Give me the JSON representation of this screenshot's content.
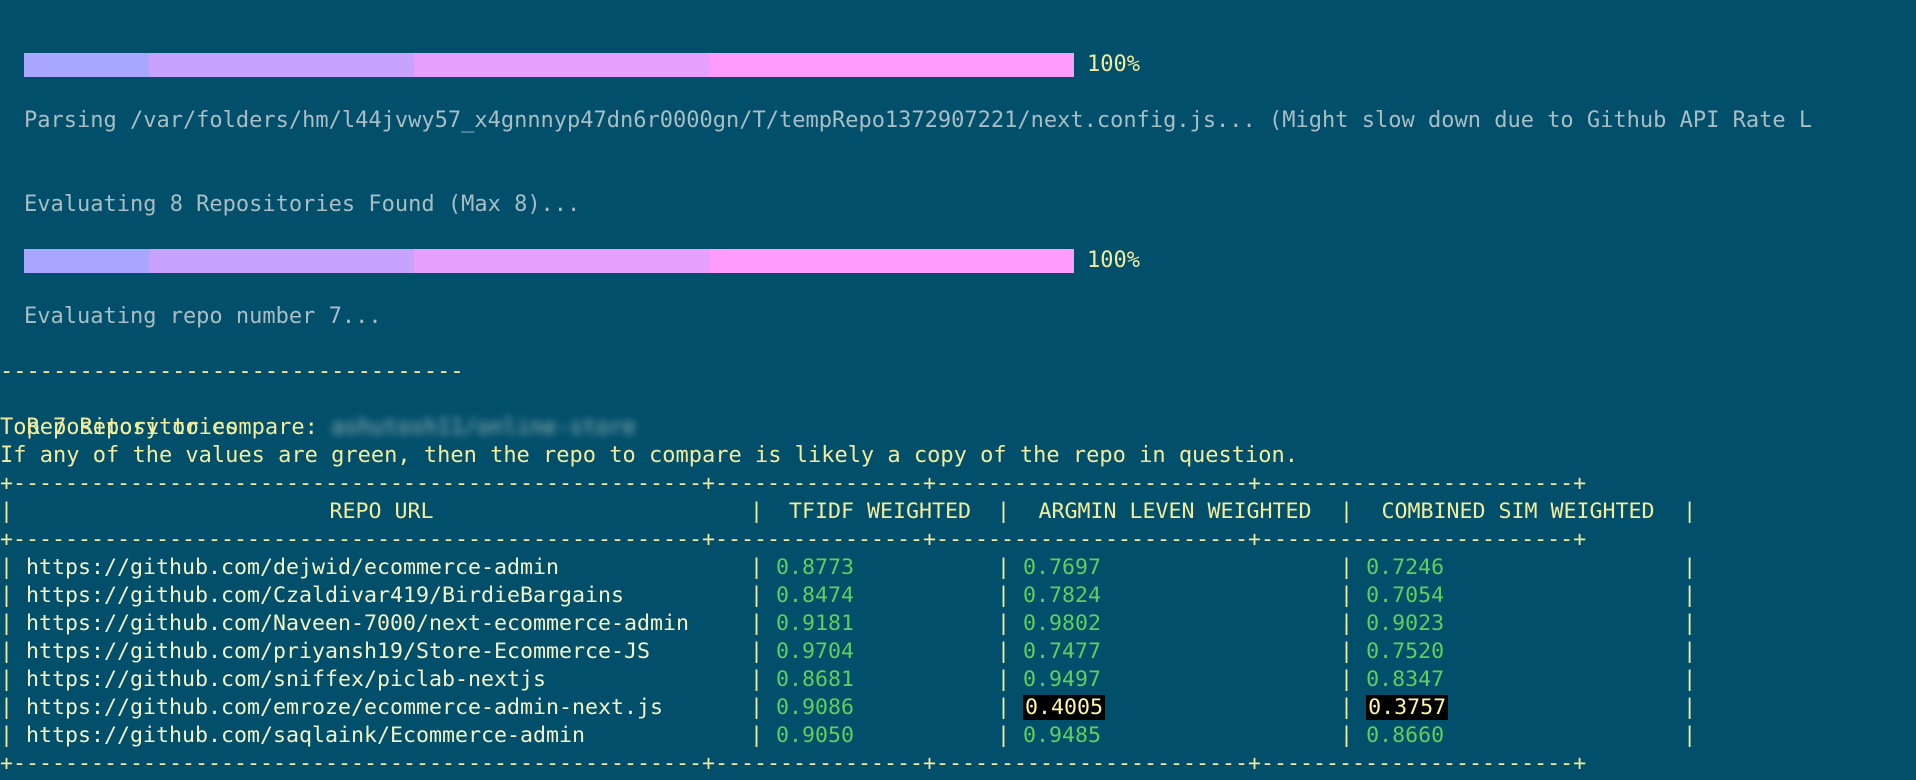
{
  "progress1": {
    "percent_label": "100%",
    "fill": 1.0
  },
  "parsing_text": "Parsing /var/folders/hm/l44jvwy57_x4gnnnyp47dn6r0000gn/T/tempRepo1372907221/next.config.js... (Might slow down due to Github API Rate L",
  "evaluating_found_text": "Evaluating 8 Repositories Found (Max 8)...",
  "progress2": {
    "percent_label": "100%",
    "fill": 1.0
  },
  "evaluating_repo_text": "Evaluating repo number 7...",
  "separator": "-----------------------------------",
  "compare_label": "Repository to compare: ",
  "compare_value": "ashutosh11/online-store",
  "top_label": "Top 7 Repositories",
  "hint_text": "If any of the values are green, then the repo to compare is likely a copy of the repo in question.",
  "table": {
    "border": "+-----------------------------------------------------+----------------+------------------------+------------------------+",
    "headers": [
      "REPO URL",
      "TFIDF WEIGHTED",
      "ARGMIN LEVEN WEIGHTED",
      "COMBINED SIM WEIGHTED"
    ],
    "rows": [
      {
        "url": "https://github.com/dejwid/ecommerce-admin",
        "tfidf": "0.8773",
        "argmin": "0.7697",
        "combined": "0.7246",
        "highlight": false
      },
      {
        "url": "https://github.com/Czaldivar419/BirdieBargains",
        "tfidf": "0.8474",
        "argmin": "0.7824",
        "combined": "0.7054",
        "highlight": false
      },
      {
        "url": "https://github.com/Naveen-7000/next-ecommerce-admin",
        "tfidf": "0.9181",
        "argmin": "0.9802",
        "combined": "0.9023",
        "highlight": false
      },
      {
        "url": "https://github.com/priyansh19/Store-Ecommerce-JS",
        "tfidf": "0.9704",
        "argmin": "0.7477",
        "combined": "0.7520",
        "highlight": false
      },
      {
        "url": "https://github.com/sniffex/piclab-nextjs",
        "tfidf": "0.8681",
        "argmin": "0.9497",
        "combined": "0.8347",
        "highlight": false
      },
      {
        "url": "https://github.com/emroze/ecommerce-admin-next.js",
        "tfidf": "0.9086",
        "argmin": "0.4005",
        "combined": "0.3757",
        "highlight": true
      },
      {
        "url": "https://github.com/saqlaink/Ecommerce-admin",
        "tfidf": "0.9050",
        "argmin": "0.9485",
        "combined": "0.8660",
        "highlight": false
      }
    ]
  },
  "colors": {
    "background": "#014f6b",
    "text_yellow": "#f2ec9c",
    "value_green": "#5ed05e",
    "progress_start": "#a8a6ff",
    "progress_end": "#ff9cfb"
  }
}
